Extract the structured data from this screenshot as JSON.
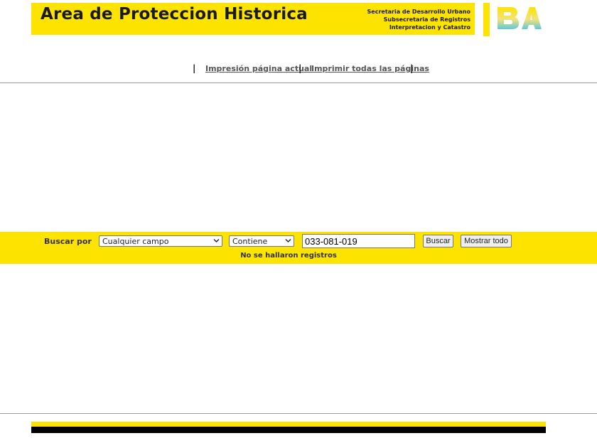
{
  "header": {
    "title": "Area de Proteccion Historica",
    "department_lines": [
      "Secretaria de Desarrollo Urbano",
      "Subsecretaria de Registros",
      "Interpretacion y Catastro"
    ],
    "logo_icon": "ba-logo-icon",
    "brand_yellow": "#fde300"
  },
  "print_links": {
    "separator": "|",
    "current_page": "Impresión página actual",
    "all_pages": "Imprimir todas las páginas"
  },
  "search": {
    "label": "Buscar por",
    "field_select": {
      "selected": "Cualquier campo"
    },
    "operator_select": {
      "selected": "Contiene"
    },
    "query_value": "033-081-019",
    "search_button": "Buscar",
    "show_all_button": "Mostrar todo",
    "result_message": "No se hallaron registros"
  },
  "footer": {
    "stripe_colors": [
      "#fde300",
      "#000000"
    ]
  }
}
